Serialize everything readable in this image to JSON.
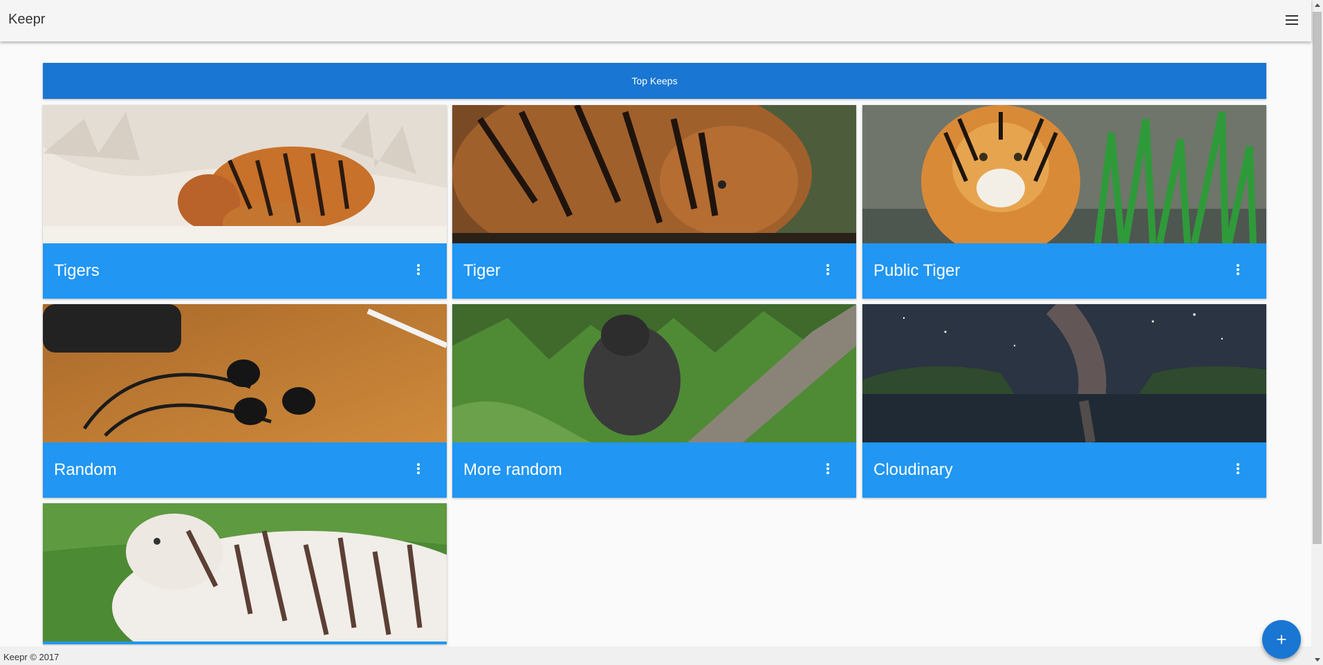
{
  "app": {
    "brand": "Keepr",
    "menu_icon": "hamburger-menu-icon"
  },
  "banner": {
    "label": "Top Keeps"
  },
  "cards": [
    {
      "title": "Tigers",
      "menu_icon": "more-vert-icon",
      "image": "tiger-mother-and-cub-in-snow"
    },
    {
      "title": "Tiger",
      "menu_icon": "more-vert-icon",
      "image": "tiger-closeup-face"
    },
    {
      "title": "Public Tiger",
      "menu_icon": "more-vert-icon",
      "image": "tiger-walking-in-water"
    },
    {
      "title": "Random",
      "menu_icon": "more-vert-icon",
      "image": "earphones-on-wooden-table"
    },
    {
      "title": "More random",
      "menu_icon": "more-vert-icon",
      "image": "gorilla-in-jungle"
    },
    {
      "title": "Cloudinary",
      "menu_icon": "more-vert-icon",
      "image": "milky-way-over-sea"
    },
    {
      "title": "",
      "menu_icon": "more-vert-icon",
      "image": "white-tiger-lying-on-grass"
    }
  ],
  "footer": {
    "text": "Keepr © 2017"
  },
  "fab": {
    "icon": "plus-icon",
    "label": "+"
  },
  "colors": {
    "primary": "#2196f3",
    "primary_dark": "#1976d2",
    "appbar": "#f5f5f5"
  }
}
